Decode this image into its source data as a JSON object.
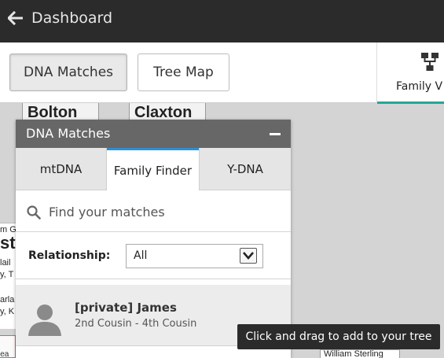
{
  "header": {
    "back_label": "Dashboard"
  },
  "toolbar": {
    "dna_matches_label": "DNA Matches",
    "tree_map_label": "Tree Map",
    "family_view_label": "Family V"
  },
  "tree": {
    "names": [
      "Bolton",
      "Claxton"
    ],
    "left_card_lines": [
      "m G",
      "ste",
      "lail",
      "y, T",
      "arla",
      "y, K"
    ],
    "bottom_left_text": "lea",
    "bottom_card_name": "William Sterling"
  },
  "panel": {
    "title": "DNA Matches",
    "tabs": [
      "mtDNA",
      "Family Finder",
      "Y-DNA"
    ],
    "active_tab": "Family Finder",
    "search_placeholder": "Find your matches",
    "relationship_label": "Relationship:",
    "relationship_value": "All",
    "matches": [
      {
        "name": "[private] James",
        "relationship": "2nd Cousin - 4th Cousin"
      }
    ]
  },
  "tooltip": {
    "text": "Click and drag to add to your tree"
  },
  "colors": {
    "topbar": "#2b2b2b",
    "panel_header": "#676767",
    "active_tab_border": "#2d8fd5",
    "family_view_underline": "#26a69a"
  },
  "icons": [
    "back-arrow-icon",
    "family-tree-icon",
    "minimize-icon",
    "search-icon",
    "chevron-down-icon",
    "avatar-silhouette-icon"
  ]
}
